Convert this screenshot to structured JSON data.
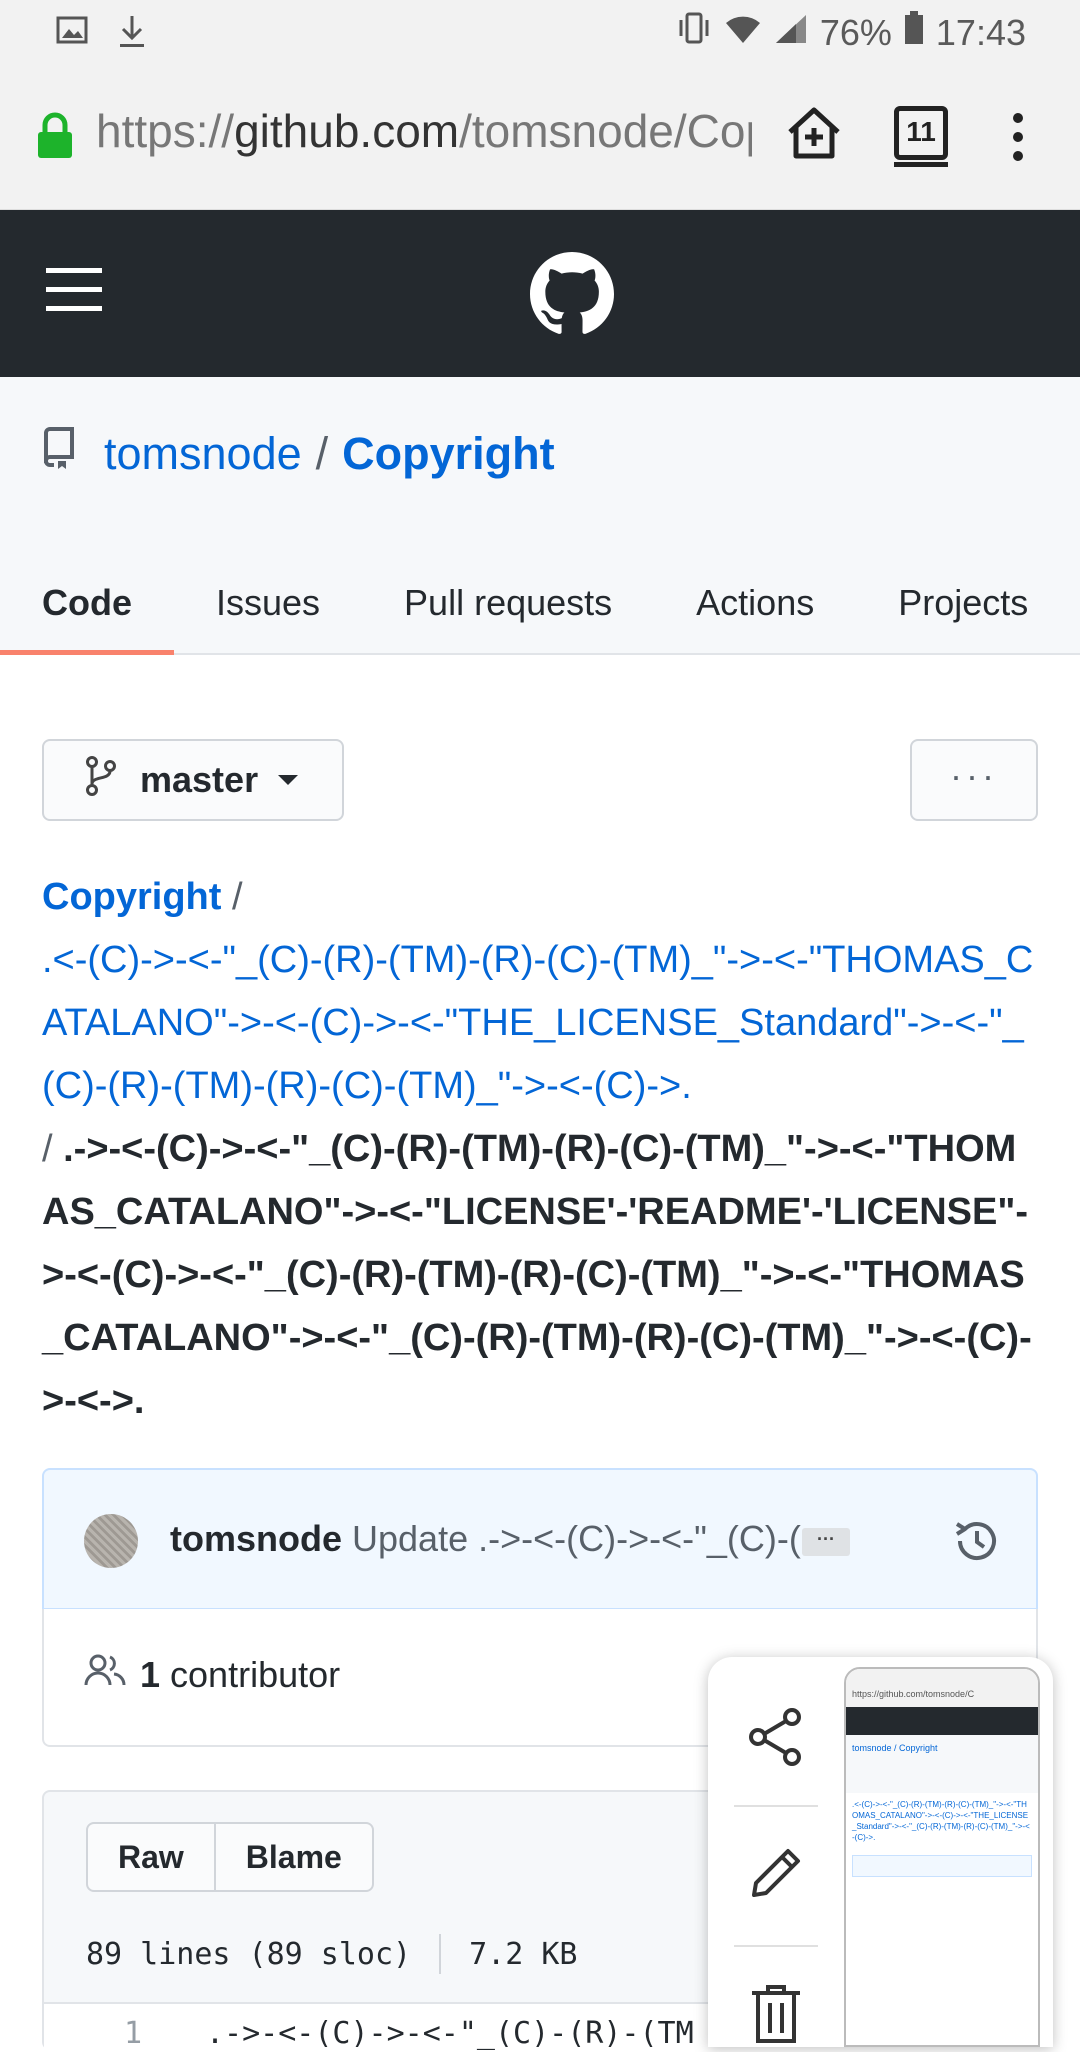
{
  "status_bar": {
    "battery": "76%",
    "time": "17:43"
  },
  "browser": {
    "url_scheme": "https://",
    "url_host": "github.com",
    "url_path": "/tomsnode/Copyright",
    "tab_count": "11"
  },
  "repo": {
    "owner": "tomsnode",
    "separator": "/",
    "name": "Copyright"
  },
  "tabs": [
    {
      "label": "Code"
    },
    {
      "label": "Issues"
    },
    {
      "label": "Pull requests"
    },
    {
      "label": "Actions"
    },
    {
      "label": "Projects"
    }
  ],
  "branch": {
    "label": "master",
    "more_label": "···"
  },
  "breadcrumb": {
    "root": "Copyright",
    "slash": " / ",
    "folder": ".<-(C)->-<-\"_(C)-(R)-(TM)-(R)-(C)-(TM)_\"->-<-\"THOMAS_CATALANO\"->-<-(C)->-<-\"THE_LICENSE_Standard\"->-<-\"_(C)-(R)-(TM)-(R)-(C)-(TM)_\"->-<-(C)->.",
    "slash2": "/ ",
    "file": ".->-<-(C)->-<-\"_(C)-(R)-(TM)-(R)-(C)-(TM)_\"->-<-\"THOMAS_CATALANO\"->-<-\"LICENSE'-'README'-'LICENSE\"->-<-(C)->-<-\"_(C)-(R)-(TM)-(R)-(C)-(TM)_\"->-<-\"THOMAS_CATALANO\"->-<-\"_(C)-(R)-(TM)-(R)-(C)-(TM)_\"->-<-(C)->-<->."
  },
  "commit": {
    "author": "tomsnode",
    "message": "Update .->-<-(C)->-<-\"_(C)-(...",
    "ellipsis": "···"
  },
  "contributors": {
    "count": "1",
    "label": "contributor"
  },
  "file": {
    "raw_label": "Raw",
    "blame_label": "Blame",
    "lines": "89 lines (89 sloc)",
    "size": "7.2 KB",
    "first_line_number": "1",
    "first_line_code": ".->-<-(C)->-<-\"_(C)-(R)-(TM"
  },
  "thumbnail": {
    "url": "https://github.com/tomsnode/C",
    "repo": "tomsnode / Copyright"
  }
}
